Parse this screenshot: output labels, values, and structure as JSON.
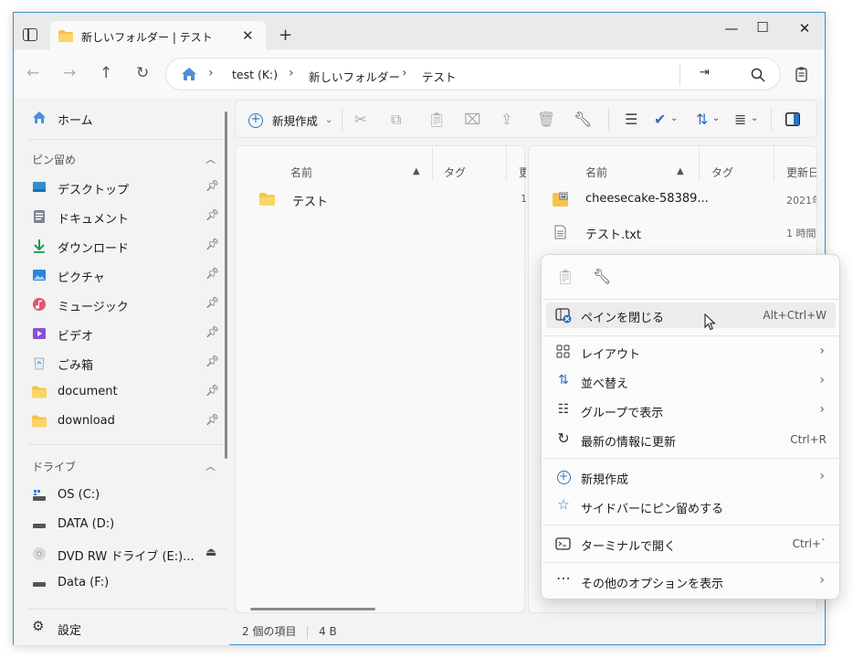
{
  "window": {
    "tab_title": "新しいフォルダー | テスト",
    "new_tab": "+"
  },
  "address": {
    "crumbs": [
      "test (K:)",
      "新しいフォルダー",
      "テスト"
    ]
  },
  "toolbar": {
    "new_label": "新規作成"
  },
  "sidebar": {
    "home": "ホーム",
    "pinned_header": "ピン留め",
    "pinned": [
      {
        "label": "デスクトップ",
        "icon": "desktop-icon"
      },
      {
        "label": "ドキュメント",
        "icon": "document-icon"
      },
      {
        "label": "ダウンロード",
        "icon": "download-icon"
      },
      {
        "label": "ピクチャ",
        "icon": "pictures-icon"
      },
      {
        "label": "ミュージック",
        "icon": "music-icon"
      },
      {
        "label": "ビデオ",
        "icon": "video-icon"
      },
      {
        "label": "ごみ箱",
        "icon": "recycle-bin-icon"
      },
      {
        "label": "document",
        "icon": "folder-icon"
      },
      {
        "label": "download",
        "icon": "folder-icon"
      }
    ],
    "drives_header": "ドライブ",
    "drives": [
      {
        "label": "OS (C:)"
      },
      {
        "label": "DATA (D:)"
      },
      {
        "label": "DVD RW ドライブ (E:)..."
      },
      {
        "label": "Data (F:)"
      }
    ],
    "settings": "設定"
  },
  "left_pane": {
    "col_name": "名前",
    "col_tag": "タグ",
    "col_third": "更",
    "rows": [
      {
        "name": "テスト",
        "extra": "1"
      }
    ]
  },
  "right_pane": {
    "col_name": "名前",
    "col_tag": "タグ",
    "col_date": "更新日",
    "rows": [
      {
        "name": "cheesecake-58389...",
        "date": "2021年"
      },
      {
        "name": "テスト.txt",
        "date": "1 時間"
      }
    ]
  },
  "status": {
    "items": "2 個の項目",
    "size": "4 B"
  },
  "context_menu": {
    "close_pane": {
      "label": "ペインを閉じる",
      "shortcut": "Alt+Ctrl+W"
    },
    "layout": "レイアウト",
    "sort": "並べ替え",
    "group": "グループで表示",
    "refresh": {
      "label": "最新の情報に更新",
      "shortcut": "Ctrl+R"
    },
    "new": "新規作成",
    "pin_sidebar": "サイドバーにピン留めする",
    "terminal": {
      "label": "ターミナルで開く",
      "shortcut": "Ctrl+`"
    },
    "more_options": "その他のオプションを表示"
  }
}
